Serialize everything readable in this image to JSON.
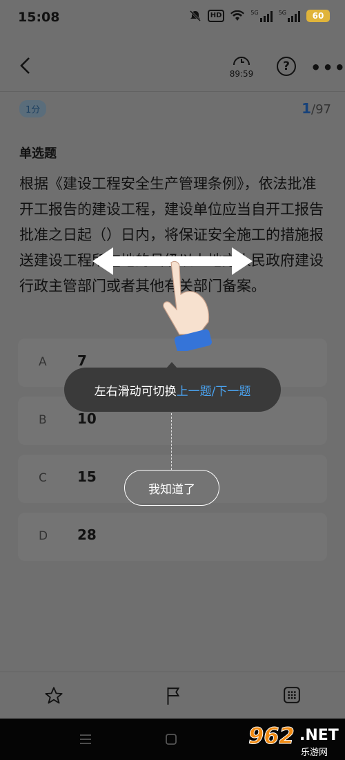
{
  "status_bar": {
    "time": "15:08",
    "signal1": "5G",
    "signal2": "5G",
    "battery": "60",
    "hd": "HD"
  },
  "header": {
    "timer": "89:59",
    "help_icon": "question-circle-icon",
    "more_icon": "more-dots-icon"
  },
  "question": {
    "score": "1分",
    "progress_current": "1",
    "progress_total": "/97",
    "type": "单选题",
    "text": "根据《建设工程安全生产管理条例》，依法批准开工报告的建设工程，建设单位应当自开工报告批准之日起（）日内，将保证安全施工的措施报送建设工程所在地的县级以上地方人民政府建设行政主管部门或者其他有关部门备案。"
  },
  "options": [
    {
      "letter": "A",
      "value": "7"
    },
    {
      "letter": "B",
      "value": "10"
    },
    {
      "letter": "C",
      "value": "15"
    },
    {
      "letter": "D",
      "value": "28"
    }
  ],
  "overlay": {
    "hint_prefix": "左右滑动可切换",
    "hint_highlight": "上一题/下一题",
    "dismiss_label": "我知道了",
    "highlight_color": "#4aa3f0"
  },
  "watermark": {
    "main": "962",
    "net": ".NET",
    "sub": "乐游网"
  }
}
